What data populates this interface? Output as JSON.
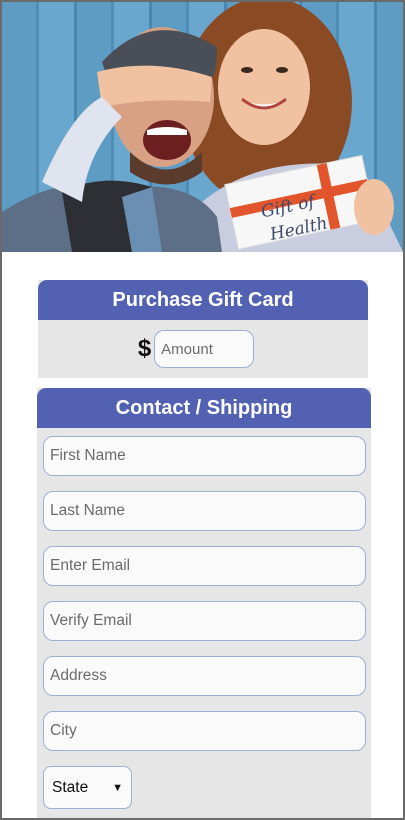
{
  "hero": {
    "gift_card_line1": "Gift of",
    "gift_card_line2": "Health",
    "colors": {
      "ribbon": "#e2542c",
      "wood": "#5f9cc4"
    }
  },
  "purchase": {
    "title": "Purchase Gift Card",
    "currency_symbol": "$",
    "amount_placeholder": "Amount"
  },
  "contact": {
    "title": "Contact / Shipping",
    "fields": {
      "first_name": "First Name",
      "last_name": "Last Name",
      "email": "Enter Email",
      "verify_email": "Verify Email",
      "address": "Address",
      "city": "City"
    },
    "state_selected": "State"
  },
  "theme": {
    "header_bg": "#5361b3",
    "panel_bg": "#e6e6e6"
  }
}
